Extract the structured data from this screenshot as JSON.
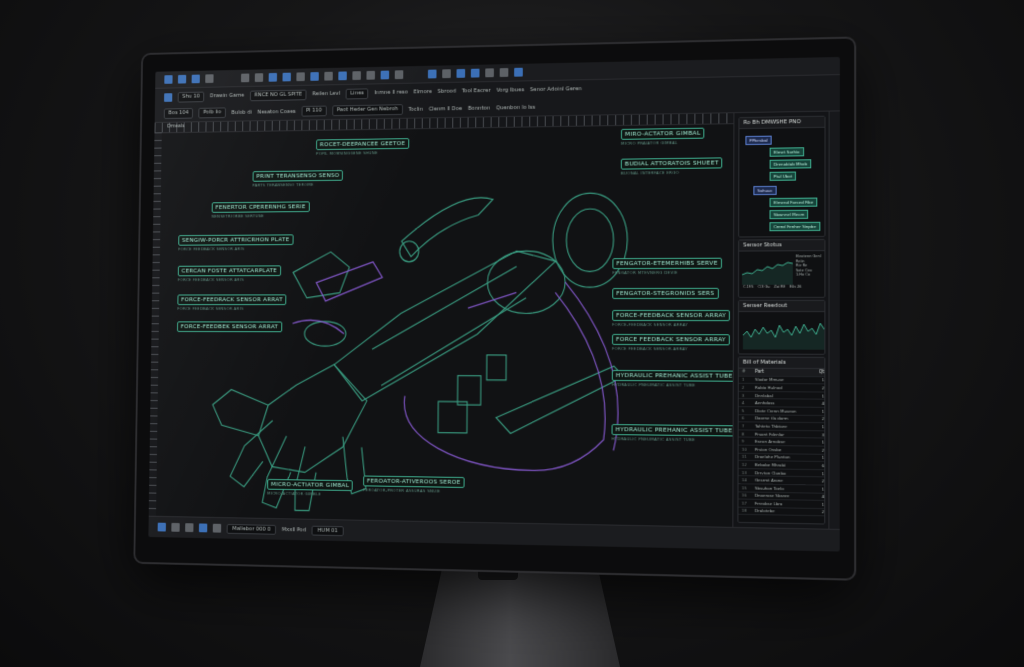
{
  "toolbar": {
    "row2": {
      "field_a": "Shu 10",
      "label_a": "Drawin Game",
      "field_b": "RNCE NO GL SPITE",
      "label_b": "Reilen Levl",
      "field_c": "Lines",
      "label_c": "Inmne ll reso",
      "label_d": "Elmore",
      "label_e": "Sbrood",
      "label_f": "Tool Eacrer",
      "label_g": "Vorg lbues",
      "label_h": "Senor Adoinl Geren"
    },
    "row3": {
      "field_a": "Bos 104",
      "field_b": "Polb lio",
      "label_a": "Bulob di",
      "label_b": "Nesaton Coaes",
      "field_c": "Pl 110",
      "field_d": "Paot Heder Gen Nebroh",
      "label_c": "Toclin",
      "label_d": "Clenm ll Doe",
      "label_e": "Bonnton",
      "label_f": "Quenbon lo lss"
    }
  },
  "canvas": {
    "header_label": "Dmeals",
    "callouts": [
      {
        "label": "ROCET-DEEPANCEE GEETOE",
        "sub": "POPIL MOMSINGGENE SHUNE"
      },
      {
        "label": "PRINT TERANSENSO SENSO",
        "sub": "PARTS TERANSENSO TEROME"
      },
      {
        "label": "FENERTOR CPERERNHG SERIE",
        "sub": "NENSETRIORBE SERTUNE"
      },
      {
        "label": "SENGIW-PORCR ATTRICRHON PLATE",
        "sub": "FORCE FEEDBACK SENSOR ARIS"
      },
      {
        "label": "CERCAN FOSTE ATTATCARPLATE",
        "sub": "FORCE FEEDBACK SENSOR ARIS"
      },
      {
        "label": "FORCE-FEEDRACK SENSOR ARRAT",
        "sub": "FORCE FEEDBACK SENSOR ARIS"
      },
      {
        "label": "FORCE-FEEDBEK SENSOR ARRAT",
        "sub": ""
      },
      {
        "label": "MICRO-ACTIATOR GIMBAL",
        "sub": "MICRO-ACTIATOR GIMBLE"
      },
      {
        "label": "FEROATOR-ATIVEROOS SEROE",
        "sub": "FEROATOR-PROTER ASSURAS SNUIE"
      },
      {
        "label": "MIRO-ACTATOR GIMBAL",
        "sub": "MICRO PRAIATOR GIMBAL"
      },
      {
        "label": "BUDIAL ATTORATOIS SHUEET",
        "sub": "BUONAL INTERFACE ERGO"
      },
      {
        "label": "FENGATOR-ETEMERHIBS SERVE",
        "sub": "FENGATOR MTEVNERG DEVIE"
      },
      {
        "label": "FENGATOR-STEGRONIDS SERS",
        "sub": ""
      },
      {
        "label": "FORCE-FEEDBACK SENSOR ARRAY",
        "sub": "FORCE-FEEDBACK SENSOR ARRAY"
      },
      {
        "label": "FORCE FEEDBACK SENSOR ARRAY",
        "sub": "FORCE FEEDBACK SENSOR ARRAY"
      },
      {
        "label": "HYDRAULIC PREHANIC ASSIST TUBE",
        "sub": "HYDRAULIC PNEUMATIC ASSIST TUBE"
      },
      {
        "label": "HYDRAULIC PREHANIC ASSIST TUBE",
        "sub": "HYDRAULIC PNEUMATIC ASSIST TUBE"
      }
    ]
  },
  "panels": {
    "hierarchy": {
      "title": "Ro Bh DMWSHE PNO",
      "nodes": [
        "PPhesbal",
        "Elmet Sorhio",
        "Drenobiab Mhob",
        "Ptul Ubot",
        "Sahuuc",
        "Elmend Forced Fibe",
        "Sbwnnel Mecm",
        "Crend Fenher Sinpbe"
      ]
    },
    "sensor_status": {
      "title": "Sensor Stotus",
      "readouts": [
        "Eleotenn Genl",
        "Reiin",
        "Rie Re",
        "Sote Ceo",
        "1.Ho Co",
        "C.1F.5",
        "C/3 Gu",
        "Zai RE",
        "E0s 26"
      ]
    },
    "sensor_readout": {
      "title": "Senser Reedout"
    },
    "bom": {
      "title": "Bill of Materials",
      "header": [
        "#",
        "Part",
        "Qt"
      ],
      "rows": [
        [
          "1",
          "Slodor Mmuse",
          "1"
        ],
        [
          "2",
          "Rabio Hulnod",
          "2"
        ],
        [
          "3",
          "Dnnlabal",
          "1"
        ],
        [
          "4",
          "Aenhdoss",
          "4"
        ],
        [
          "5",
          "Diote Crenn Museon",
          "1"
        ],
        [
          "6",
          "Daorne tla dorm",
          "2"
        ],
        [
          "7",
          "Tahteto Thbtore",
          "1"
        ],
        [
          "8",
          "Prsont Fdenlar",
          "3"
        ],
        [
          "9",
          "Eseon Arnobse",
          "1"
        ],
        [
          "10",
          "Prsion Onsbe",
          "2"
        ],
        [
          "11",
          "Droelohe Plunton",
          "1"
        ],
        [
          "12",
          "Bebobe Mhrobi",
          "6"
        ],
        [
          "13",
          "Drrvton Clonbo",
          "1"
        ],
        [
          "14",
          "Gesrmt Arone",
          "2"
        ],
        [
          "15",
          "Sbsuhon Toelo",
          "1"
        ],
        [
          "16",
          "Dnoerose Sbsnre",
          "4"
        ],
        [
          "17",
          "Frreobse Lbro",
          "1"
        ],
        [
          "18",
          "Dralotebe",
          "2"
        ]
      ]
    }
  },
  "status_bar": {
    "field": "Mallebor 000 0",
    "label": "Mxxll Pod",
    "zoom": "HUM 01"
  },
  "colors": {
    "accent_teal": "#3fae8f",
    "accent_purple": "#8a5cd6",
    "toolbar_blue": "#3b6fb6",
    "screen_bg": "#111214"
  }
}
